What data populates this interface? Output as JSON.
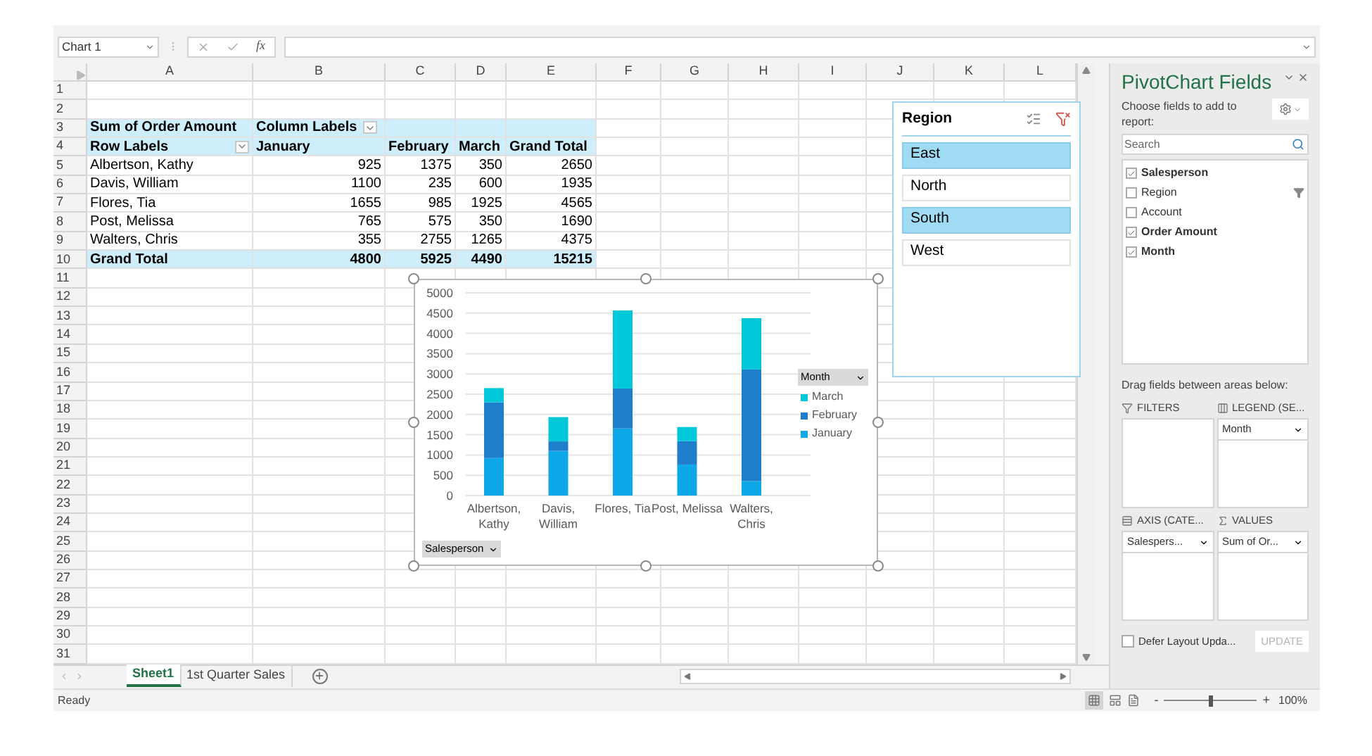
{
  "formula_bar": {
    "name_box": "Chart 1",
    "fx": "fx"
  },
  "column_headers": [
    "A",
    "B",
    "C",
    "D",
    "E",
    "F",
    "G",
    "H",
    "I",
    "J",
    "K",
    "L"
  ],
  "row_headers": [
    "1",
    "2",
    "3",
    "4",
    "5",
    "6",
    "7",
    "8",
    "9",
    "10",
    "11",
    "12",
    "13",
    "14",
    "15",
    "16",
    "17",
    "18",
    "19",
    "20",
    "21",
    "22",
    "23",
    "24",
    "25",
    "26",
    "27",
    "28",
    "29",
    "30",
    "31"
  ],
  "pivot_table": {
    "value_field": "Sum of Order Amount",
    "column_labels": {
      "text": "Column Labels",
      "dropdown": true
    },
    "row_labels": {
      "text": "Row Labels",
      "dropdown": true
    },
    "columns": [
      "January",
      "February",
      "March",
      "Grand Total"
    ],
    "rows": [
      {
        "label": "Albertson, Kathy",
        "values": [
          "925",
          "1375",
          "350",
          "2650"
        ]
      },
      {
        "label": "Davis, William",
        "values": [
          "1100",
          "235",
          "600",
          "1935"
        ]
      },
      {
        "label": "Flores, Tia",
        "values": [
          "1655",
          "985",
          "1925",
          "4565"
        ]
      },
      {
        "label": "Post, Melissa",
        "values": [
          "765",
          "575",
          "350",
          "1690"
        ]
      },
      {
        "label": "Walters, Chris",
        "values": [
          "355",
          "2755",
          "1265",
          "4375"
        ]
      }
    ],
    "grand_total": {
      "label": "Grand Total",
      "values": [
        "4800",
        "5925",
        "4490",
        "15215"
      ]
    }
  },
  "chart": {
    "legend_button": "Month",
    "axis_button": "Salesperson",
    "selected": true,
    "chart_data": {
      "type": "bar",
      "stacked": true,
      "orientation": "vertical",
      "categories": [
        "Albertson, Kathy",
        "Davis, William",
        "Flores, Tia",
        "Post, Melissa",
        "Walters, Chris"
      ],
      "series": [
        {
          "name": "January",
          "color": "#0ea8e8",
          "values": [
            925,
            1100,
            1655,
            765,
            355
          ]
        },
        {
          "name": "February",
          "color": "#1f7ecb",
          "values": [
            1375,
            235,
            985,
            575,
            2755
          ]
        },
        {
          "name": "March",
          "color": "#00c8d8",
          "values": [
            350,
            600,
            1925,
            350,
            1265
          ]
        }
      ],
      "grid": true,
      "legend": true,
      "ylim": [
        0,
        5000
      ],
      "yticks": [
        0,
        500,
        1000,
        1500,
        2000,
        2500,
        3000,
        3500,
        4000,
        4500,
        5000
      ]
    }
  },
  "slicer": {
    "title": "Region",
    "items": [
      {
        "label": "East",
        "selected": true
      },
      {
        "label": "North",
        "selected": false
      },
      {
        "label": "South",
        "selected": true
      },
      {
        "label": "West",
        "selected": false
      }
    ]
  },
  "sheet_tabs": [
    {
      "label": "Sheet1",
      "selected": true
    },
    {
      "label": "1st Quarter Sales",
      "selected": false
    }
  ],
  "status_bar": {
    "text": "Ready",
    "zoom": {
      "minus": "-",
      "plus": "+",
      "level": 0.5,
      "reading": "100%"
    }
  },
  "pivot_panel": {
    "title": "PivotChart Fields",
    "instruction": "Choose fields to add to report:",
    "search": {
      "placeholder": "Search"
    },
    "fields": [
      {
        "label": "Salesperson",
        "checked": true,
        "filtered": false
      },
      {
        "label": "Region",
        "checked": false,
        "filtered": true
      },
      {
        "label": "Account",
        "checked": false,
        "filtered": false
      },
      {
        "label": "Order Amount",
        "checked": true,
        "filtered": false
      },
      {
        "label": "Month",
        "checked": true,
        "filtered": false
      }
    ],
    "areas_hint": "Drag fields between areas below:",
    "areas": [
      {
        "kind": "filters",
        "title": "FILTERS"
      },
      {
        "kind": "legend",
        "title": "LEGEND (SE...",
        "items": [
          "Month"
        ]
      },
      {
        "kind": "axis",
        "title": "AXIS (CATE...",
        "items": [
          "Salespers..."
        ]
      },
      {
        "kind": "values",
        "title": "VALUES",
        "items": [
          "Sum of Or..."
        ]
      }
    ],
    "defer": {
      "label": "Defer Layout Upda...",
      "checked": false
    },
    "update_button": {
      "label": "UPDATE",
      "disabled": true
    }
  }
}
